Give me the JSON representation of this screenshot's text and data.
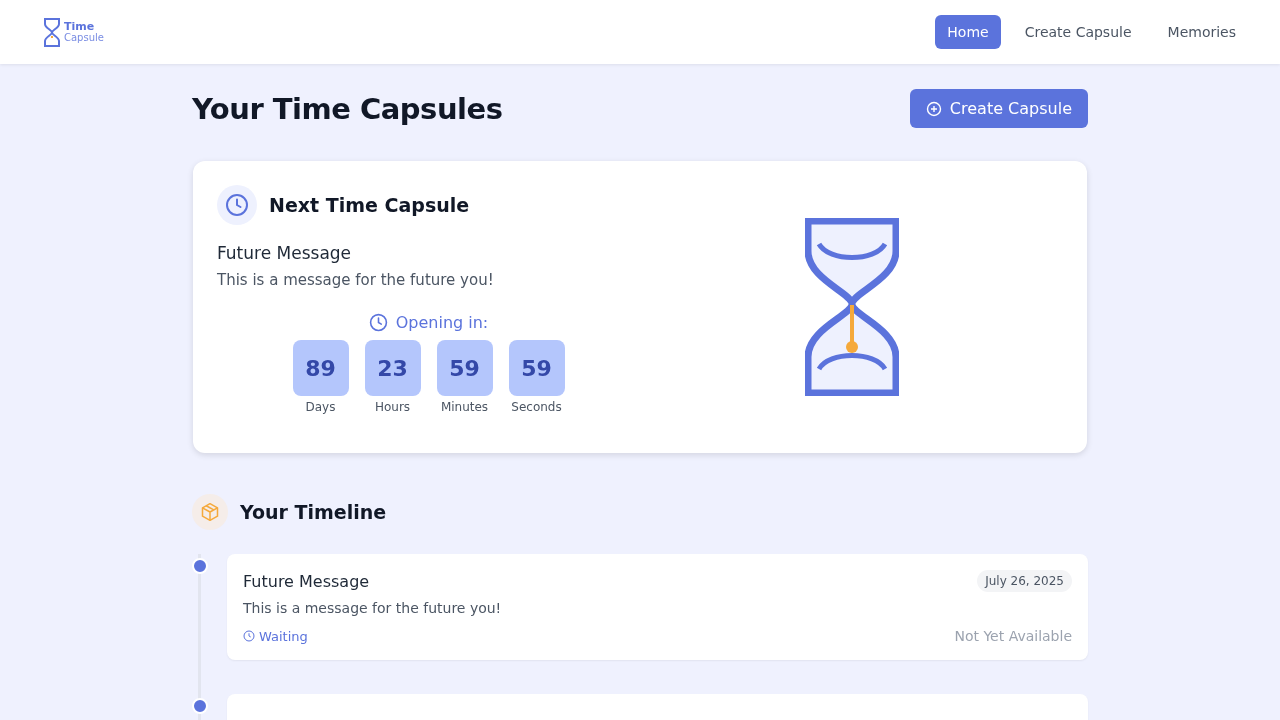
{
  "brand": {
    "line1": "Time",
    "line2": "Capsule"
  },
  "nav": [
    {
      "label": "Home",
      "selected": true
    },
    {
      "label": "Create Capsule",
      "selected": false
    },
    {
      "label": "Memories",
      "selected": false
    }
  ],
  "page_title": "Your Time Capsules",
  "create_button": "Create Capsule",
  "next_capsule": {
    "heading": "Next Time Capsule",
    "title": "Future Message",
    "message": "This is a message for the future you!",
    "countdown_label": "Opening in:",
    "countdown": [
      {
        "value": "89",
        "unit": "Days"
      },
      {
        "value": "23",
        "unit": "Hours"
      },
      {
        "value": "59",
        "unit": "Minutes"
      },
      {
        "value": "59",
        "unit": "Seconds"
      }
    ]
  },
  "timeline": {
    "heading": "Your Timeline",
    "items": [
      {
        "title": "Future Message",
        "date": "July 26, 2025",
        "message": "This is a message for the future you!",
        "status": "Waiting",
        "availability": "Not Yet Available"
      }
    ]
  }
}
